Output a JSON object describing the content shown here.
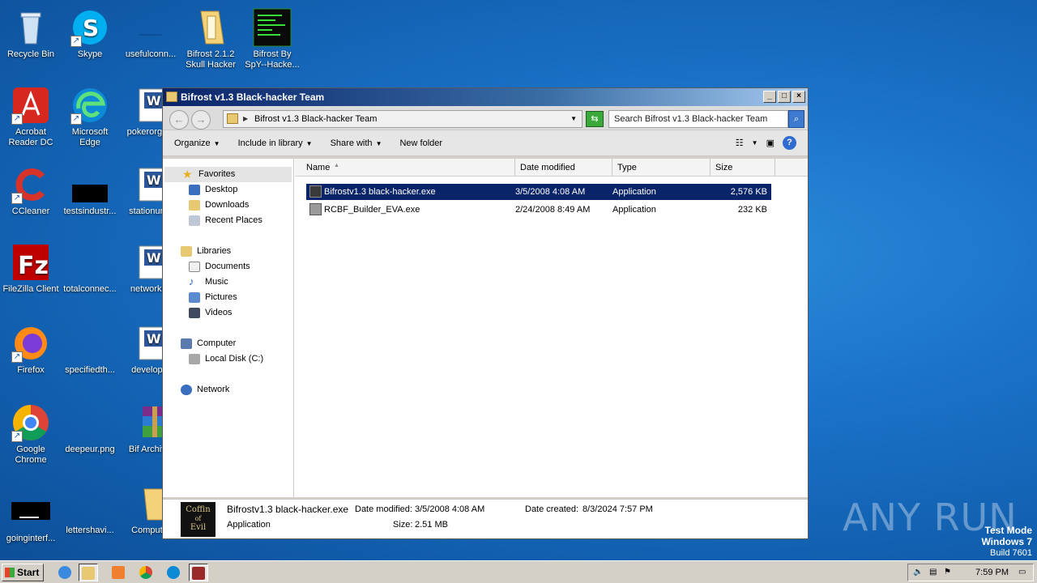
{
  "desktop": {
    "icons": [
      {
        "label": "Recycle Bin"
      },
      {
        "label": "Skype"
      },
      {
        "label": "usefulconn..."
      },
      {
        "label": "Bifrost 2.1.2 Skull Hacker"
      },
      {
        "label": "Bifrost By SpY--Hacke..."
      },
      {
        "label": "Acrobat Reader DC"
      },
      {
        "label": "Microsoft Edge"
      },
      {
        "label": "pokerorga..."
      },
      {
        "label": "CCleaner"
      },
      {
        "label": "testsindustr..."
      },
      {
        "label": "stationun..."
      },
      {
        "label": "FileZilla Client"
      },
      {
        "label": "totalconnec..."
      },
      {
        "label": "networki..."
      },
      {
        "label": "Firefox"
      },
      {
        "label": "specifiedth..."
      },
      {
        "label": "develop..."
      },
      {
        "label": "Google Chrome"
      },
      {
        "label": "deepeur.png"
      },
      {
        "label": "Bif Archiv..."
      },
      {
        "label": "goinginterf..."
      },
      {
        "label": "lettershavi..."
      },
      {
        "label": "Comput..."
      }
    ]
  },
  "watermark": "ANY RUN",
  "test_mode": {
    "line1": "Test Mode",
    "line2": "Windows 7",
    "line3": "Build 7601"
  },
  "window": {
    "title": "Bifrost v1.3 Black-hacker Team",
    "address": "Bifrost v1.3 Black-hacker Team",
    "search_placeholder": "Search Bifrost v1.3 Black-hacker Team",
    "toolbar": {
      "organize": "Organize",
      "include_in_library": "Include in library",
      "share_with": "Share with",
      "new_folder": "New folder"
    },
    "nav": {
      "favorites": "Favorites",
      "desktop": "Desktop",
      "downloads": "Downloads",
      "recent_places": "Recent Places",
      "libraries": "Libraries",
      "documents": "Documents",
      "music": "Music",
      "pictures": "Pictures",
      "videos": "Videos",
      "computer": "Computer",
      "local_disk": "Local Disk (C:)",
      "network": "Network"
    },
    "columns": {
      "name": "Name",
      "date": "Date modified",
      "type": "Type",
      "size": "Size"
    },
    "files": [
      {
        "name": "Bifrostv1.3 black-hacker.exe",
        "date": "3/5/2008 4:08 AM",
        "type": "Application",
        "size": "2,576 KB"
      },
      {
        "name": "RCBF_Builder_EVA.exe",
        "date": "2/24/2008 8:49 AM",
        "type": "Application",
        "size": "232 KB"
      }
    ],
    "details": {
      "thumb_line1": "Coffin",
      "thumb_line2": "of",
      "thumb_line3": "Evil",
      "name": "Bifrostv1.3 black-hacker.exe",
      "type": "Application",
      "date_modified_label": "Date modified:",
      "date_modified": "3/5/2008 4:08 AM",
      "size_label": "Size:",
      "size": "2.51 MB",
      "date_created_label": "Date created:",
      "date_created": "8/3/2024 7:57 PM"
    }
  },
  "taskbar": {
    "start": "Start",
    "clock": "7:59 PM"
  }
}
